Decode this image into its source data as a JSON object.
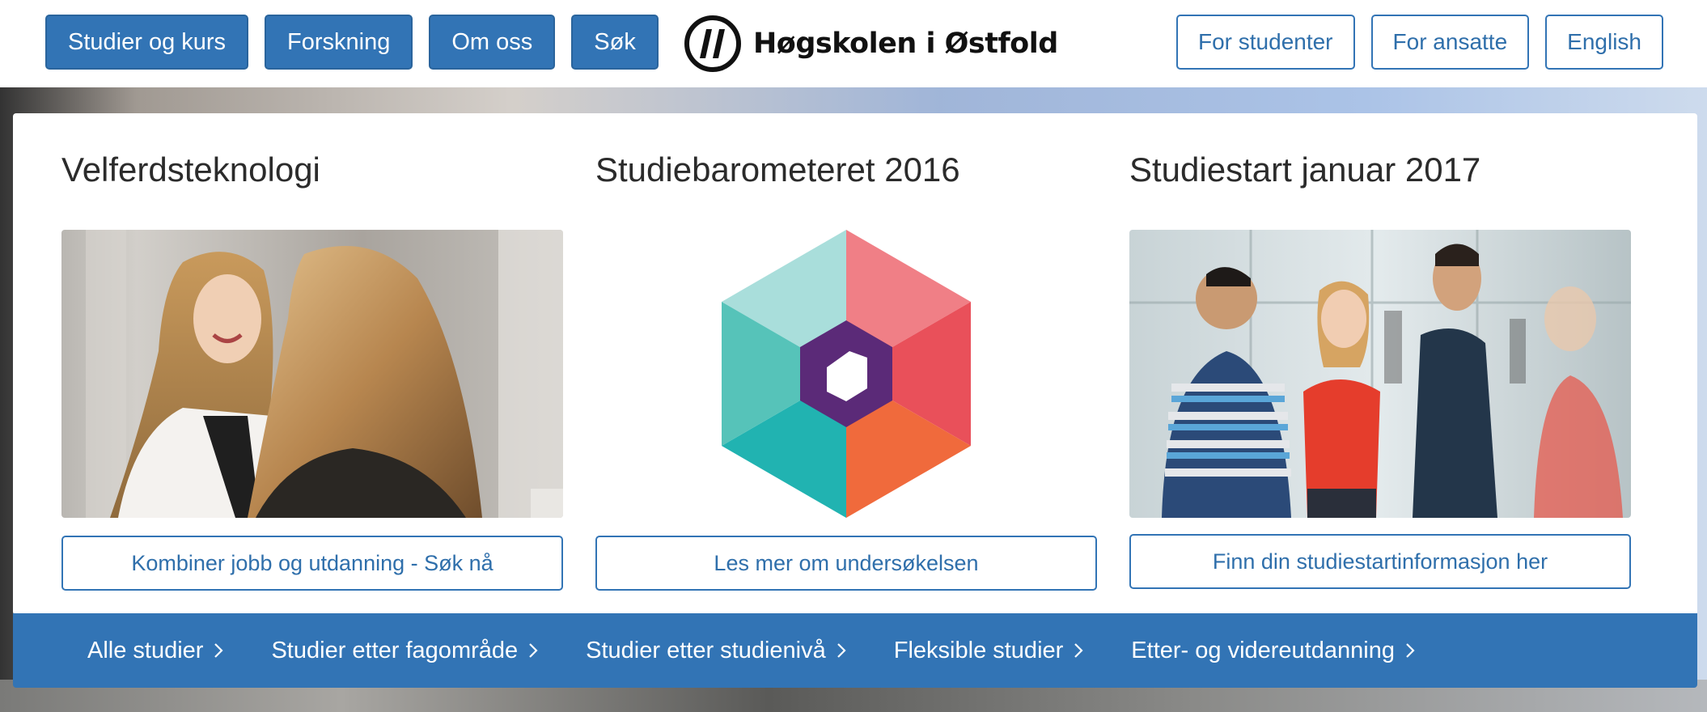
{
  "header": {
    "nav_left": [
      "Studier og kurs",
      "Forskning",
      "Om oss",
      "Søk"
    ],
    "logo_text": "Høgskolen i Østfold",
    "nav_right": [
      "For studenter",
      "For ansatte",
      "English"
    ]
  },
  "featured": [
    {
      "title": "Velferdsteknologi",
      "image": "photo-two-women-talking",
      "button": "Kombiner jobb og utdanning - Søk nå"
    },
    {
      "title": "Studiebarometeret 2016",
      "image": "studiebarometeret-hexagon-logo",
      "button": "Les mer om undersøkelsen"
    },
    {
      "title": "Studiestart januar 2017",
      "image": "photo-students-chatting",
      "button": "Finn din studiestartinformasjon her"
    }
  ],
  "study_nav": [
    "Alle studier",
    "Studier etter fagområde",
    "Studier etter studienivå",
    "Fleksible studier",
    "Etter- og videreutdanning"
  ],
  "colors": {
    "brand_blue": "#3274b5",
    "link_blue": "#2f6fab",
    "hex_purple": "#5b2a78"
  }
}
